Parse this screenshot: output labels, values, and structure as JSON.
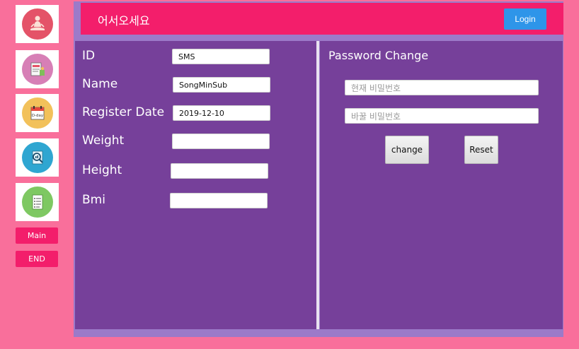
{
  "sidebar": {
    "icons": [
      {
        "name": "meditation-icon",
        "color": "#e45368"
      },
      {
        "name": "diet-board-icon",
        "color": "#d77fb6"
      },
      {
        "name": "calendar-dday-icon",
        "color": "#f2c15a"
      },
      {
        "name": "search-report-icon",
        "color": "#2fa6d1"
      },
      {
        "name": "checklist-icon",
        "color": "#7ec862"
      }
    ],
    "main_label": "Main",
    "end_label": "END"
  },
  "header": {
    "title": "어서오세요",
    "login_label": "Login"
  },
  "profile": {
    "id_label": "ID",
    "id_value": "SMS",
    "name_label": "Name",
    "name_value": "SongMinSub",
    "register_label": "Register Date",
    "register_value": "2019-12-10",
    "weight_label": "Weight",
    "weight_value": "",
    "height_label": "Height",
    "height_value": "",
    "bmi_label": "Bmi",
    "bmi_value": ""
  },
  "password": {
    "title": "Password Change",
    "current_placeholder": "현재 비밀번호",
    "new_placeholder": "바꿀 비밀번호",
    "change_label": "change",
    "reset_label": "Reset"
  },
  "colors": {
    "background": "#f96f9b",
    "accent": "#f31e6b",
    "panel": "#76409a",
    "login_button": "#2e95e9"
  }
}
